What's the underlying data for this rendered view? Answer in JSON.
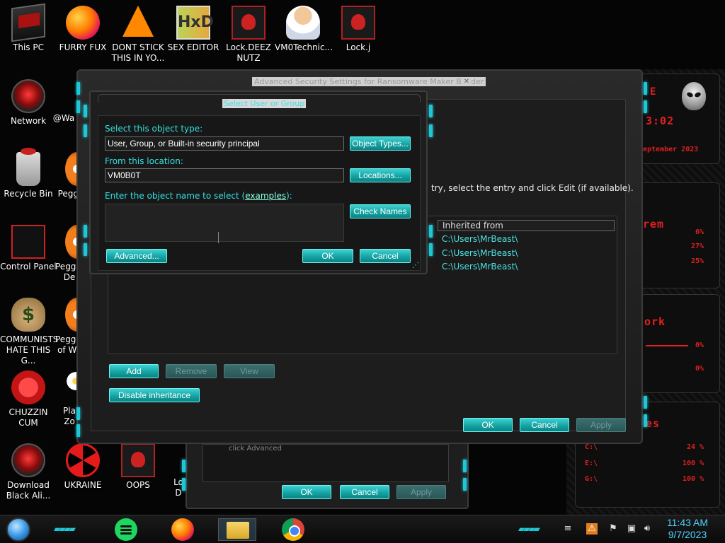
{
  "desktop_icons": [
    {
      "label": "This PC",
      "icon": "this-pc-icon"
    },
    {
      "label": "FURRY FUX",
      "icon": "firefox-icon"
    },
    {
      "label": "DONT STICK\nTHIS IN YO...",
      "icon": "vlc-cone-icon"
    },
    {
      "label": "SEX EDITOR",
      "icon": "hxd-icon"
    },
    {
      "label": "Lock.DEEZ\nNUTZ",
      "icon": "lock-file-icon"
    },
    {
      "label": "VM0Technic...",
      "icon": "doctor-icon"
    },
    {
      "label": "Lock.j",
      "icon": "lock-file-icon"
    },
    {
      "label": "Network",
      "icon": "alien-network-icon"
    },
    {
      "label": "@Wa",
      "icon": "partial-icon"
    },
    {
      "label": "Recycle Bin",
      "icon": "recycle-bin-icon"
    },
    {
      "label": "Peggl",
      "icon": "peggle-icon"
    },
    {
      "label": "Control Panel",
      "icon": "control-panel-icon"
    },
    {
      "label": "Peggle\nDe",
      "icon": "peggle-icon"
    },
    {
      "label": "COMMUNISTS\nHATE THIS G...",
      "icon": "money-bag-icon"
    },
    {
      "label": "Peggle\nof Wa",
      "icon": "peggle-icon"
    },
    {
      "label": "CHUZZIN\nCUM",
      "icon": "chuzzle-icon"
    },
    {
      "label": "Pla\nZo",
      "icon": "flower-icon"
    },
    {
      "label": "Download\nBlack Ali...",
      "icon": "alien-download-icon"
    },
    {
      "label": "UKRAINE",
      "icon": "radiation-icon"
    },
    {
      "label": "OOPS",
      "icon": "lock-file-icon"
    },
    {
      "label": "Lo\nD",
      "icon": "partial-icon"
    }
  ],
  "security_window": {
    "title": "Advanced Security Settings for Ransomware Maker Builder",
    "close": "✕",
    "instruction": "try, select the entry and click Edit (if available).",
    "column_header": "Inherited from",
    "inherited_rows": [
      "C:\\Users\\MrBeast\\",
      "C:\\Users\\MrBeast\\",
      "C:\\Users\\MrBeast\\"
    ],
    "add": "Add",
    "remove": "Remove",
    "view": "View",
    "disable_inheritance": "Disable inheritance",
    "ok": "OK",
    "cancel": "Cancel",
    "apply": "Apply"
  },
  "third_dialog": {
    "partial_text": "click Advanced",
    "ok": "OK",
    "cancel": "Cancel",
    "apply": "Apply"
  },
  "select_dialog": {
    "title": "Select User or Group",
    "object_type_label": "Select this object type:",
    "object_type_value": "User, Group, or Built-in security principal",
    "object_types_button": "Object Types...",
    "location_label": "From this location:",
    "location_value": "VM0B0T",
    "locations_button": "Locations...",
    "enter_label": "Enter the object name to select (",
    "examples_link": "examples",
    "enter_label_end": "):",
    "check_names_button": "Check Names",
    "advanced_button": "Advanced...",
    "ok_button": "OK",
    "cancel_button": "Cancel"
  },
  "gadget": {
    "time": "3:02",
    "date": "eptember 2023",
    "mem_label": "rem",
    "mem_values": [
      "6%",
      "27%",
      "25%"
    ],
    "net_label": "ork",
    "net_values": [
      "0%",
      "0%"
    ],
    "disk_label": "es",
    "drives": [
      {
        "name": "C:\\",
        "value": "24 %"
      },
      {
        "name": "E:\\",
        "value": "100 %"
      },
      {
        "name": "G:\\",
        "value": "100 %"
      }
    ]
  },
  "taskbar": {
    "apps": [
      "spotify-icon",
      "firefox-icon",
      "file-explorer-icon",
      "chrome-icon"
    ],
    "time": "11:43 AM",
    "date": "9/7/2023"
  },
  "colors": {
    "accent_teal": "#15a4a4",
    "label_cyan": "#34e1e1",
    "gadget_red": "#e02020"
  }
}
